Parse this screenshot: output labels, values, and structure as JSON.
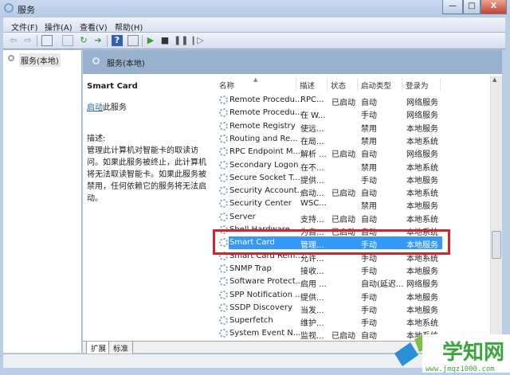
{
  "window": {
    "title": "服务",
    "minimize": "—",
    "maximize": "□",
    "close": "X"
  },
  "menu": [
    "文件(F)",
    "操作(A)",
    "查看(V)",
    "帮助(H)"
  ],
  "toolbar": {
    "icons": [
      "back-icon",
      "forward-icon",
      "console-tree-icon",
      "properties-icon",
      "refresh-icon",
      "export-icon",
      "help-icon",
      "show-hide-icon",
      "play-icon",
      "stop-icon",
      "pause-icon",
      "restart-icon"
    ]
  },
  "tree": {
    "root": "服务(本地)"
  },
  "band": {
    "title": "服务(本地)"
  },
  "detail": {
    "name": "Smart Card",
    "start_link": "启动",
    "start_suffix": "此服务",
    "desc_label": "描述:",
    "desc_text": "管理此计算机对智能卡的取读访问。如果此服务被终止，此计算机将无法取读智能卡。如果此服务被禁用，任何依赖它的服务将无法启动。"
  },
  "columns": [
    "名称",
    "描述",
    "状态",
    "启动类型",
    "登录为"
  ],
  "rows": [
    [
      "Remote Procedu...",
      "RPC...",
      "已启动",
      "自动",
      "网络服务"
    ],
    [
      "Remote Procedu...",
      "在 W...",
      "",
      "手动",
      "网络服务"
    ],
    [
      "Remote Registry",
      "使远...",
      "",
      "禁用",
      "本地服务"
    ],
    [
      "Routing and Re...",
      "在局...",
      "",
      "禁用",
      "本地系统"
    ],
    [
      "RPC Endpoint M...",
      "解析 ...",
      "已启动",
      "自动",
      "网络服务"
    ],
    [
      "Secondary Logon",
      "在不...",
      "",
      "禁用",
      "本地系统"
    ],
    [
      "Secure Socket T...",
      "提供...",
      "",
      "手动",
      "本地服务"
    ],
    [
      "Security Account...",
      "启动...",
      "已启动",
      "自动",
      "本地系统"
    ],
    [
      "Security Center",
      "WSC...",
      "",
      "禁用",
      "本地服务"
    ],
    [
      "Server",
      "支持...",
      "已启动",
      "自动",
      "本地系统"
    ],
    [
      "Shell Hardware ...",
      "为自...",
      "已启动",
      "自动",
      "本地系统"
    ],
    [
      "Smart Card",
      "管理...",
      "",
      "手动",
      "本地服务"
    ],
    [
      "Smart Card Rem...",
      "允许...",
      "",
      "手动",
      "本地系统"
    ],
    [
      "SNMP Trap",
      "接收...",
      "",
      "手动",
      "本地服务"
    ],
    [
      "Software Protect...",
      "启用 ...",
      "",
      "自动(延迟...",
      "网络服务"
    ],
    [
      "SPP Notification ...",
      "提供...",
      "",
      "手动",
      "本地服务"
    ],
    [
      "SSDP Discovery",
      "当发...",
      "",
      "手动",
      "本地服务"
    ],
    [
      "Superfetch",
      "维护...",
      "",
      "手动",
      "本地系统"
    ],
    [
      "System Event N...",
      "监视...",
      "已启动",
      "自动",
      "本地系统"
    ]
  ],
  "selected_index": 11,
  "tabs": [
    "扩展",
    "标准"
  ],
  "watermark": {
    "name": "学知网",
    "url": "www.jmqz1000.com"
  }
}
